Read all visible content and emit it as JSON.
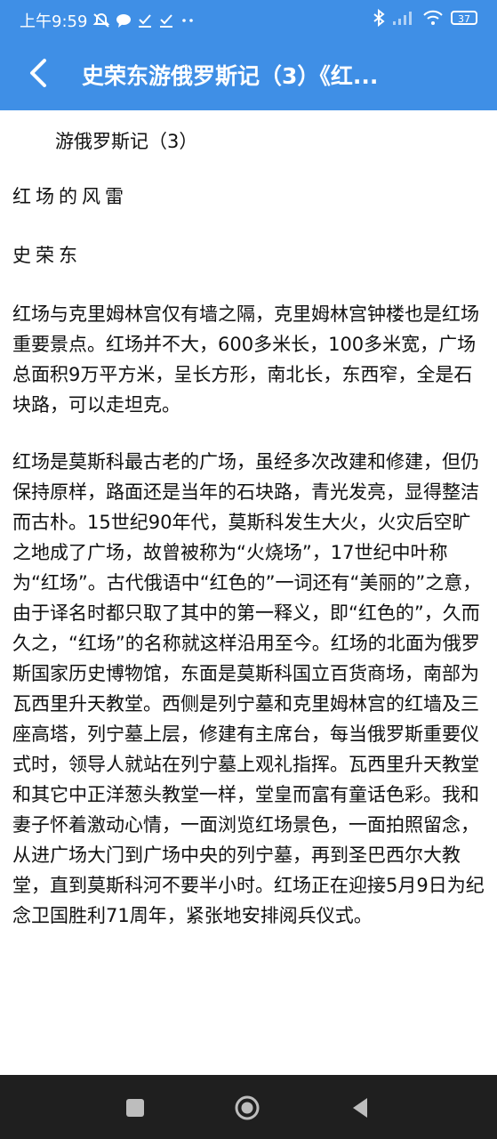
{
  "status_bar": {
    "time": "上午9:59",
    "battery": "37",
    "colors": {
      "background": "#3f8fe6",
      "text": "#ffffff"
    },
    "left_icons": [
      "mute-icon",
      "chat-bubble-icon",
      "download-done-icon",
      "download-done-icon",
      "more-dots-icon"
    ],
    "right_icons": [
      "bluetooth-icon",
      "cellular-signal-icon",
      "wifi-icon",
      "battery-icon"
    ]
  },
  "app_bar": {
    "title": "史荣东游俄罗斯记（3）《红...",
    "back_icon": "chevron-left-icon",
    "color": "#3f8fe6"
  },
  "article": {
    "subtitle": "游俄罗斯记（3）",
    "heading": "红场的风雷",
    "author": "史荣东",
    "paragraphs": [
      "红场与克里姆林宫仅有墙之隔，克里姆林宫钟楼也是红场重要景点。红场并不大，600多米长，100多米宽，广场总面积9万平方米，呈长方形，南北长，东西窄，全是石块路，可以走坦克。",
      "红场是莫斯科最古老的广场，虽经多次改建和修建，但仍保持原样，路面还是当年的石块路，青光发亮，显得整洁而古朴。15世纪90年代，莫斯科发生大火，火灾后空旷之地成了广场，故曾被称为“火烧场”，17世纪中叶称为“红场”。古代俄语中“红色的”一词还有“美丽的”之意，由于译名时都只取了其中的第一释义，即“红色的”，久而久之，“红场”的名称就这样沿用至今。红场的北面为俄罗斯国家历史博物馆，东面是莫斯科国立百货商场，南部为瓦西里升天教堂。西侧是列宁墓和克里姆林宫的红墙及三座高塔，列宁墓上层，修建有主席台，每当俄罗斯重要仪式时，领导人就站在列宁墓上观礼指挥。瓦西里升天教堂和其它中正洋葱头教堂一样，堂皇而富有童话色彩。我和妻子怀着激动心情，一面浏览红场景色，一面拍照留念，从进广场大门到广场中央的列宁墓，再到圣巴西尔大教堂，直到莫斯科河不要半小时。红场正在迎接5月9日为纪念卫国胜利71周年，紧张地安排阅兵仪式。"
    ]
  },
  "nav_bar": {
    "color": "#1f1f1f",
    "icons": [
      "recents-square-icon",
      "home-circle-icon",
      "back-triangle-icon"
    ]
  }
}
